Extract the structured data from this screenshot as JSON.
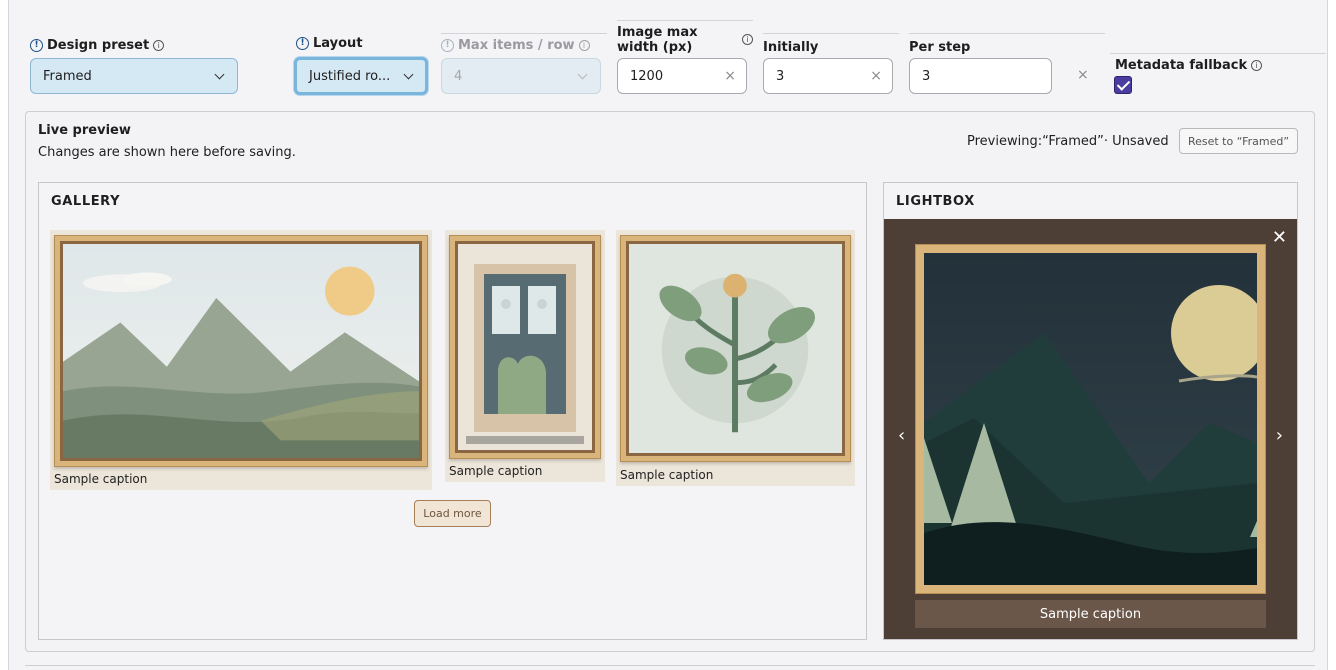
{
  "settings": {
    "design_preset": {
      "label": "Design preset",
      "value": "Framed"
    },
    "layout": {
      "label": "Layout",
      "value": "Justified ro..."
    },
    "max_items": {
      "label": "Max items / row",
      "value": "4"
    },
    "image_max_width": {
      "label_line1": "Image max",
      "label_line2": "width (px)",
      "value": "1200"
    },
    "initially": {
      "label": "Initially",
      "value": "3"
    },
    "per_step": {
      "label": "Per step",
      "value": "3"
    },
    "metadata_fallback": {
      "label": "Metadata fallback",
      "checked": true
    }
  },
  "icons": {
    "warning": "!",
    "info": "i",
    "clear": "×",
    "close": "✕",
    "prev": "‹",
    "next": "›"
  },
  "preview": {
    "title": "Live preview",
    "subtitle": "Changes are shown here before saving.",
    "status": "Previewing:“Framed”· Unsaved",
    "reset_label": "Reset to “Framed”"
  },
  "gallery": {
    "title": "GALLERY",
    "items": [
      {
        "caption": "Sample caption",
        "image": "landscape-mountains"
      },
      {
        "caption": "Sample caption",
        "image": "building-door"
      },
      {
        "caption": "Sample caption",
        "image": "botanical-branch"
      }
    ],
    "load_more": "Load more"
  },
  "lightbox": {
    "title": "LIGHTBOX",
    "caption": "Sample caption",
    "image": "night-mountains-moon"
  },
  "colors": {
    "accent": "#1b4f86",
    "select_bg": "#d5e9f5",
    "checkbox": "#4b3ca0",
    "frame_gold": "#d9b57b",
    "lightbox_bg": "#4d3f36"
  }
}
